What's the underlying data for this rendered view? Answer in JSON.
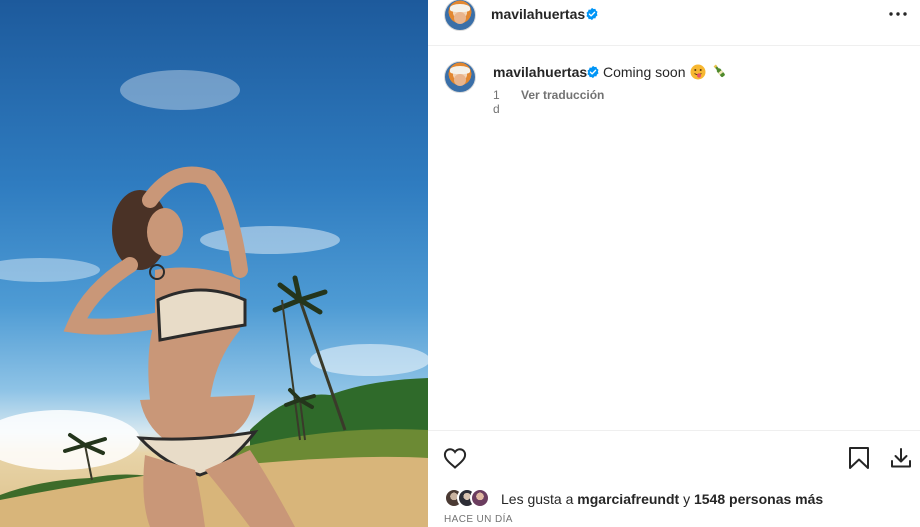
{
  "post": {
    "username": "mavilahuertas",
    "verified": true,
    "caption_text": "Coming soon",
    "caption_emojis": [
      "grinning-face-tongue-emoji",
      "champagne-bottle-emoji"
    ],
    "caption_time": "1 d",
    "translate_label": "Ver traducción",
    "likes_prefix": "Les gusta a",
    "likes_user": "mgarciafreundt",
    "likes_connector": "y",
    "likes_others": "1548 personas más",
    "date_label": "HACE UN DÍA"
  },
  "icons": {
    "more": "more-options-icon",
    "like": "heart-icon",
    "save": "bookmark-icon",
    "download": "download-icon",
    "verified": "verified-badge-icon"
  },
  "colors": {
    "verified_blue": "#0095f6",
    "text": "#262626",
    "secondary_text": "#737373",
    "divider": "#efefef"
  }
}
